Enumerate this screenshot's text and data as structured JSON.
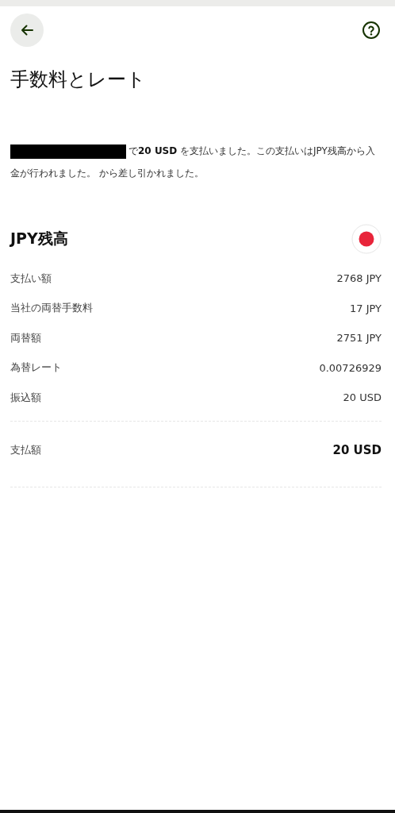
{
  "header": {
    "title": "手数料とレート"
  },
  "description": {
    "text": "で**20 USD** を支払いました。この支払いはJPY残高から入金が行われました。 から差し引かれました。",
    "redacted": true
  },
  "balance": {
    "title": "JPY残高"
  },
  "rows": [
    {
      "label": "支払い額",
      "value": "2768 JPY"
    },
    {
      "label": "当社の両替手数料",
      "value": "17 JPY"
    },
    {
      "label": "両替額",
      "value": "2751 JPY"
    },
    {
      "label": "為替レート",
      "value": "0.00726929"
    },
    {
      "label": "振込額",
      "value": "20 USD"
    }
  ],
  "total": {
    "label": "支払額",
    "value": "20 USD"
  }
}
